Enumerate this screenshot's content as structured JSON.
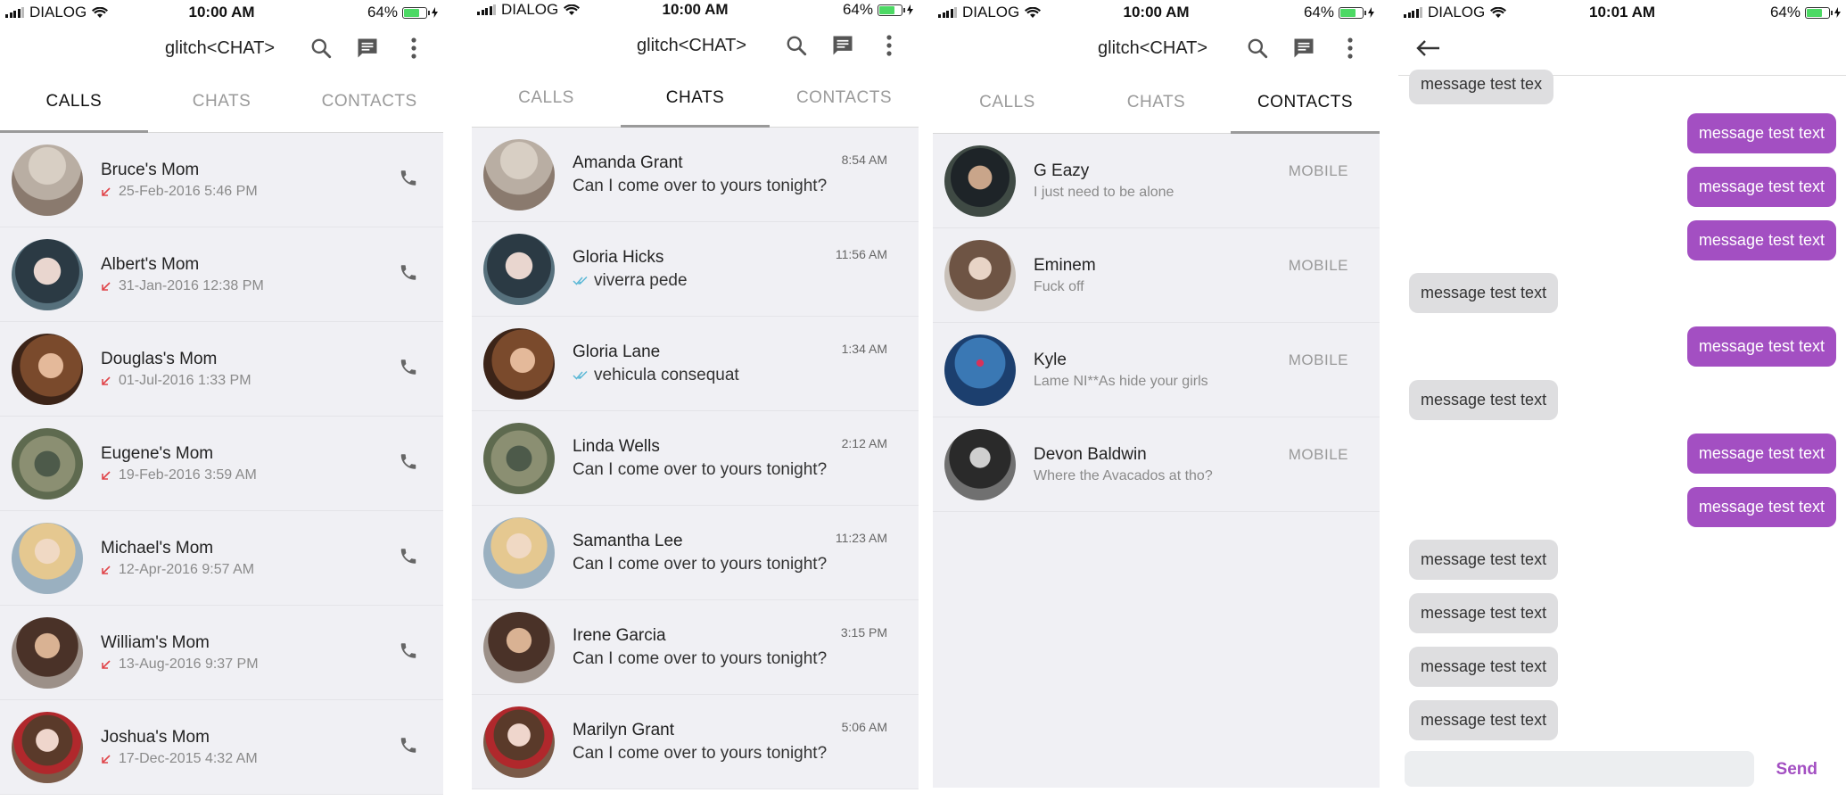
{
  "phones": [
    {
      "status": {
        "carrier": "DIALOG",
        "time": "10:00 AM",
        "battery": "64%"
      },
      "title": "glitch<CHAT>",
      "tabs": [
        "CALLS",
        "CHATS",
        "CONTACTS"
      ],
      "active_tab": "CALLS",
      "calls": [
        {
          "name": "Bruce's Mom",
          "date": "25-Feb-2016 5:46 PM"
        },
        {
          "name": "Albert's Mom",
          "date": "31-Jan-2016 12:38 PM"
        },
        {
          "name": "Douglas's Mom",
          "date": "01-Jul-2016 1:33 PM"
        },
        {
          "name": "Eugene's Mom",
          "date": "19-Feb-2016 3:59 AM"
        },
        {
          "name": "Michael's Mom",
          "date": "12-Apr-2016 9:57 AM"
        },
        {
          "name": "William's Mom",
          "date": "13-Aug-2016 9:37 PM"
        },
        {
          "name": "Joshua's Mom",
          "date": "17-Dec-2015 4:32 AM"
        }
      ]
    },
    {
      "status": {
        "carrier": "DIALOG",
        "time": "10:00 AM",
        "battery": "64%"
      },
      "title": "glitch<CHAT>",
      "tabs": [
        "CALLS",
        "CHATS",
        "CONTACTS"
      ],
      "active_tab": "CHATS",
      "chats": [
        {
          "name": "Amanda Grant",
          "message": "Can I come over to yours tonight?",
          "time": "8:54 AM"
        },
        {
          "name": "Gloria Hicks",
          "message": "viverra pede",
          "time": "11:56 AM",
          "read": true
        },
        {
          "name": "Gloria Lane",
          "message": "vehicula consequat",
          "time": "1:34 AM",
          "read": true
        },
        {
          "name": "Linda Wells",
          "message": "Can I come over to yours tonight?",
          "time": "2:12 AM"
        },
        {
          "name": "Samantha Lee",
          "message": "Can I come over to yours tonight?",
          "time": "11:23 AM"
        },
        {
          "name": "Irene Garcia",
          "message": "Can I come over to yours tonight?",
          "time": "3:15 PM"
        },
        {
          "name": "Marilyn Grant",
          "message": "Can I come over to yours tonight?",
          "time": "5:06 AM"
        }
      ]
    },
    {
      "status": {
        "carrier": "DIALOG",
        "time": "10:00 AM",
        "battery": "64%"
      },
      "title": "glitch<CHAT>",
      "tabs": [
        "CALLS",
        "CHATS",
        "CONTACTS"
      ],
      "active_tab": "CONTACTS",
      "contacts": [
        {
          "name": "G Eazy",
          "status": "I just need to be alone",
          "type": "MOBILE"
        },
        {
          "name": "Eminem",
          "status": "Fuck off",
          "type": "MOBILE"
        },
        {
          "name": "Kyle",
          "status": "Lame NI**As hide your girls",
          "type": "MOBILE"
        },
        {
          "name": "Devon Baldwin",
          "status": "Where the Avacados at tho?",
          "type": "MOBILE"
        }
      ]
    },
    {
      "status": {
        "carrier": "DIALOG",
        "time": "10:01 AM",
        "battery": "64%"
      },
      "messages": [
        {
          "text": "message test tex",
          "dir": "in"
        },
        {
          "text": "message test text",
          "dir": "out"
        },
        {
          "text": "message test text",
          "dir": "out"
        },
        {
          "text": "message test text",
          "dir": "out"
        },
        {
          "text": "message test text",
          "dir": "in"
        },
        {
          "text": "message test text",
          "dir": "out"
        },
        {
          "text": "message test text",
          "dir": "in"
        },
        {
          "text": "message test text",
          "dir": "out"
        },
        {
          "text": "message test text",
          "dir": "out"
        },
        {
          "text": "message test text",
          "dir": "in"
        },
        {
          "text": "message test text",
          "dir": "in"
        },
        {
          "text": "message test text",
          "dir": "in"
        },
        {
          "text": "message test text",
          "dir": "in"
        }
      ],
      "send_label": "Send"
    }
  ],
  "colors": {
    "accent": "#a34fc2",
    "missed": "#e0454a",
    "read_tick": "#5bb8d6"
  },
  "icons": [
    "search-icon",
    "message-icon",
    "more-vert-icon",
    "phone-icon",
    "missed-call-icon",
    "double-check-icon",
    "back-arrow-icon"
  ]
}
